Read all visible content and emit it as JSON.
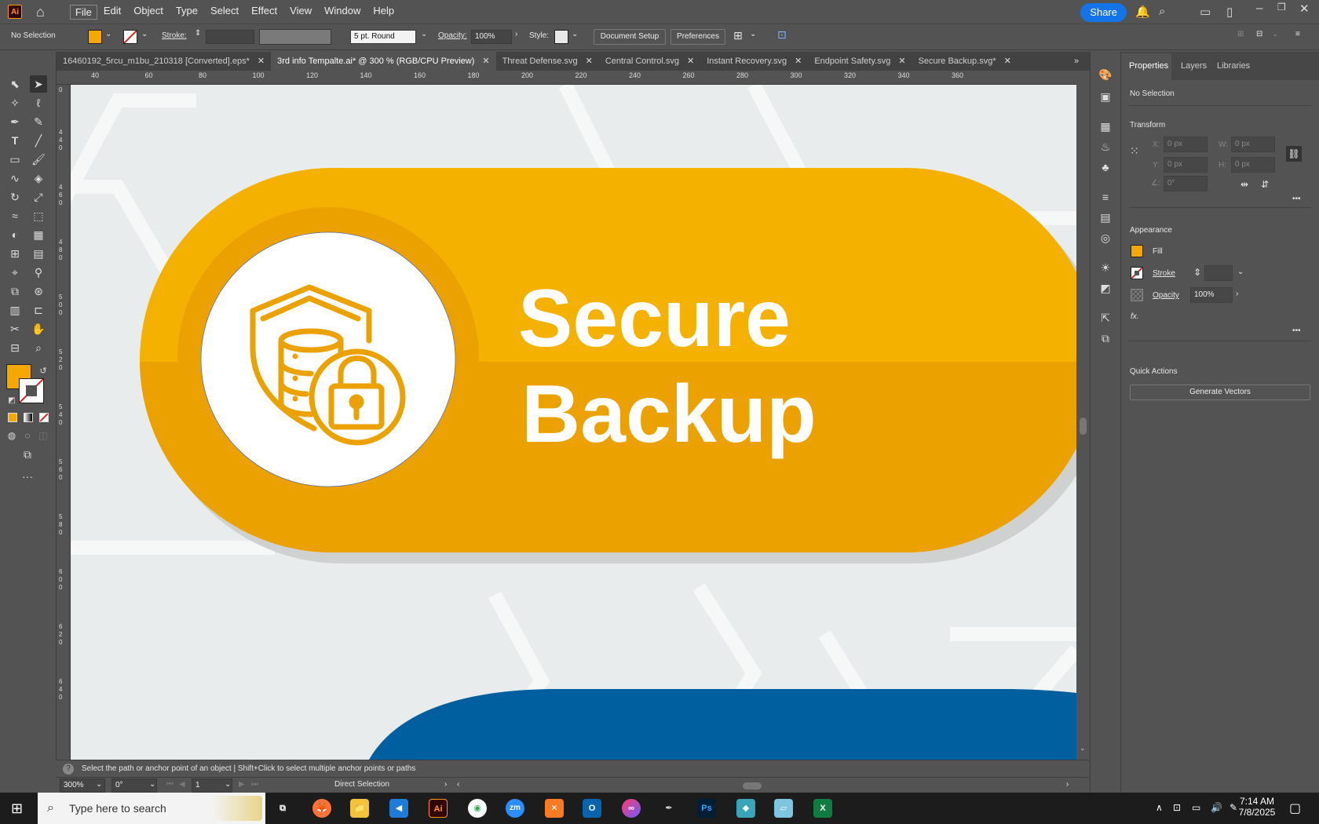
{
  "app": {
    "logo": "Ai"
  },
  "menu": [
    "File",
    "Edit",
    "Object",
    "Type",
    "Select",
    "Effect",
    "View",
    "Window",
    "Help"
  ],
  "share_label": "Share",
  "control": {
    "selection": "No Selection",
    "stroke_label": "Stroke:",
    "brush": "5 pt. Round",
    "opacity_label": "Opacity:",
    "opacity": "100%",
    "style_label": "Style:",
    "doc_setup": "Document Setup",
    "preferences": "Preferences",
    "fill_color": "#f5a800"
  },
  "tabs": [
    {
      "label": "16460192_5rcu_m1bu_210318 [Converted].eps*",
      "active": false
    },
    {
      "label": "3rd info Tempalte.ai* @ 300 % (RGB/CPU Preview)",
      "active": true
    },
    {
      "label": "Threat Defense.svg",
      "active": false
    },
    {
      "label": "Central Control.svg",
      "active": false
    },
    {
      "label": "Instant Recovery.svg",
      "active": false
    },
    {
      "label": "Endpoint Safety.svg",
      "active": false
    },
    {
      "label": "Secure Backup.svg*",
      "active": false
    }
  ],
  "ruler_top": [
    "40",
    "60",
    "80",
    "100",
    "120",
    "140",
    "160",
    "180",
    "200",
    "220",
    "240",
    "260",
    "280",
    "300",
    "320",
    "340",
    "360"
  ],
  "ruler_left": [
    "0",
    "4 4 0",
    "4 6 0",
    "4 8 0",
    "5 0 0",
    "5 2 0",
    "5 4 0",
    "5 6 0",
    "5 8 0",
    "6 0 0",
    "6 2 0",
    "6 4 0"
  ],
  "artwork": {
    "title_line1": "Secure",
    "title_line2": "Backup",
    "primary": "#f5b100",
    "dark": "#eba200",
    "blue": "#005f9e"
  },
  "panel": {
    "tabs": [
      "Properties",
      "Layers",
      "Libraries"
    ],
    "selection": "No Selection",
    "transform": "Transform",
    "x_label": "X:",
    "y_label": "Y:",
    "w_label": "W:",
    "h_label": "H:",
    "x": "0 px",
    "y": "0 px",
    "w": "0 px",
    "h": "0 px",
    "angle": "0°",
    "appearance": "Appearance",
    "fill": "Fill",
    "stroke": "Stroke",
    "opacity_label": "Opacity",
    "opacity": "100%",
    "fx": "fx.",
    "quick_actions": "Quick Actions",
    "generate_vectors": "Generate Vectors"
  },
  "status": {
    "hint": "Select the path or anchor point of an object  |  Shift+Click to select multiple anchor points or paths",
    "zoom": "300%",
    "rotation": "0°",
    "artboard": "1",
    "tool": "Direct Selection"
  },
  "taskbar": {
    "search_placeholder": "Type here to search",
    "time": "7:14 AM",
    "date": "7/8/2025"
  }
}
